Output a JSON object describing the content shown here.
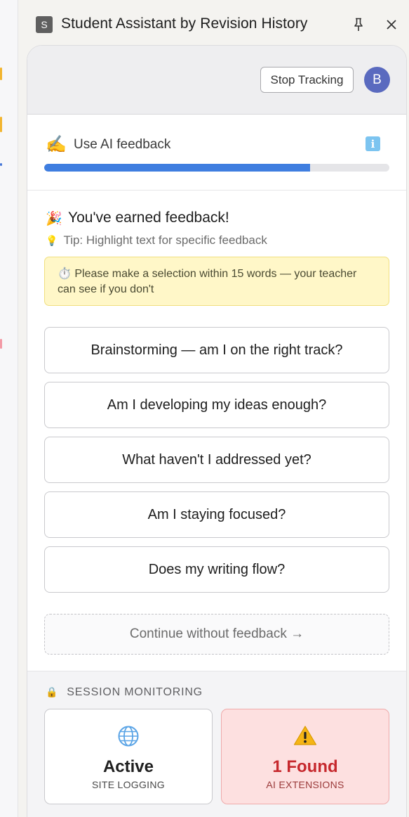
{
  "window": {
    "app_icon_letter": "S",
    "title": "Student Assistant by Revision History"
  },
  "header": {
    "stop_tracking_label": "Stop Tracking",
    "avatar_initial": "B"
  },
  "ai_feedback": {
    "emoji": "✍️",
    "label": "Use AI feedback",
    "info_label": "i",
    "progress_fraction": 0.77,
    "progress_color": "#3f7ee0"
  },
  "feedback": {
    "earned_emoji": "🎉",
    "earned_title": "You've earned feedback!",
    "tip_icon": "💡",
    "tip": "Tip: Highlight text for specific feedback",
    "warning": "⏱️  Please make a selection within 15 words — your teacher can see if you don't",
    "options": [
      "Brainstorming — am I on the right track?",
      "Am I developing my ideas enough?",
      "What haven't I addressed yet?",
      "Am I staying focused?",
      "Does my writing flow?"
    ],
    "continue_label": "Continue without feedback →"
  },
  "monitoring": {
    "lock_icon": "🔒",
    "heading": "SESSION MONITORING",
    "site": {
      "value": "Active",
      "label": "SITE LOGGING",
      "icon": "globe-icon"
    },
    "ai": {
      "value": "1 Found",
      "label": "AI EXTENSIONS",
      "icon": "warning-icon",
      "accent": "#c6282d"
    }
  }
}
